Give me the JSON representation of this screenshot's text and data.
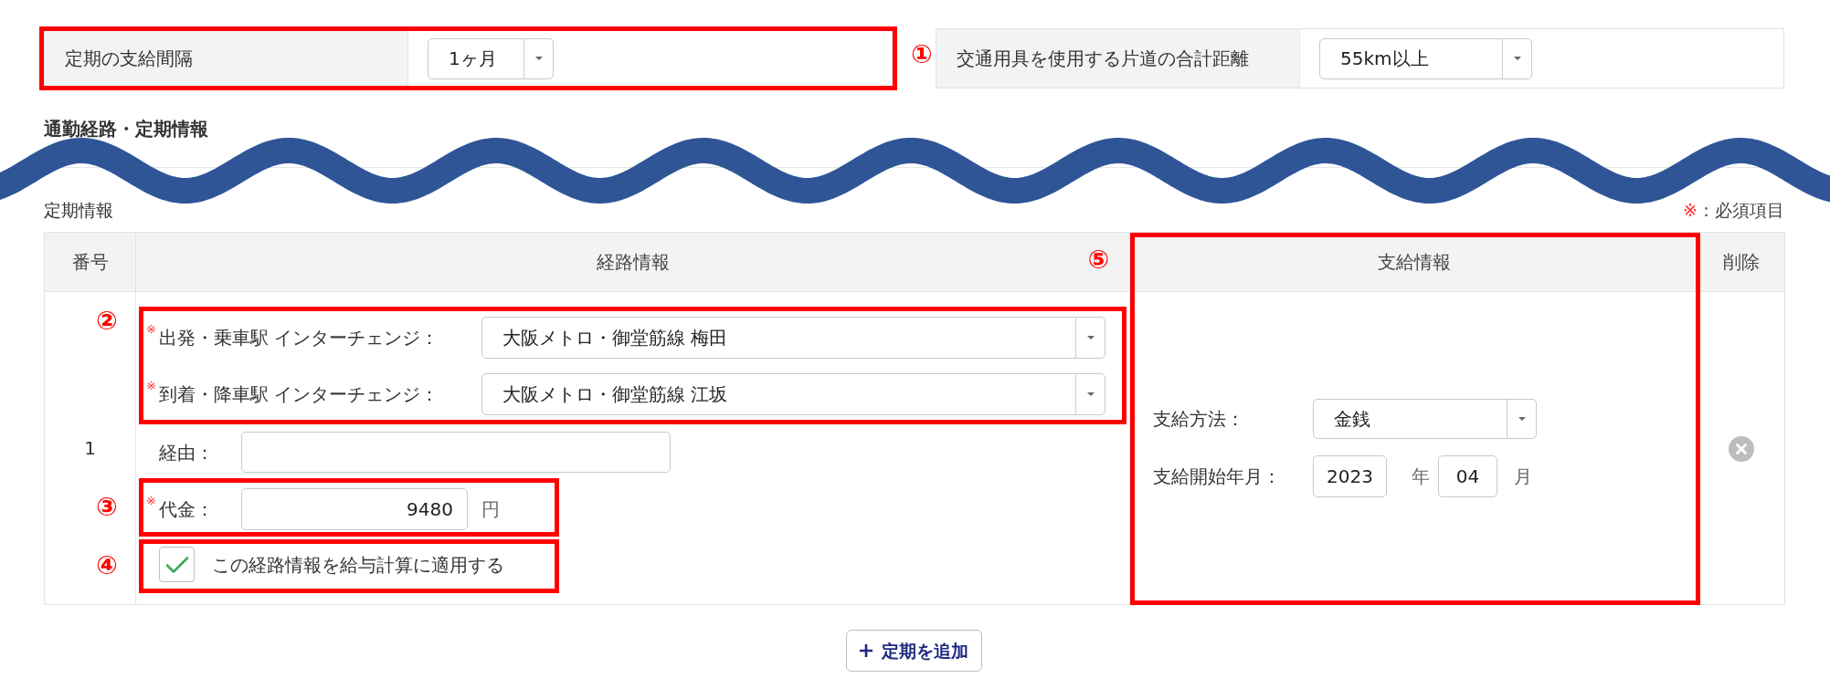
{
  "settings": [
    {
      "label": "定期の支給間隔",
      "value": "1ヶ月",
      "callout": "①"
    },
    {
      "label": "交通用具を使用する片道の合計距離",
      "value": "55km以上"
    }
  ],
  "section": {
    "title": "通勤経路・定期情報"
  },
  "pass_info": {
    "title": "定期情報",
    "legend": {
      "mark": "※",
      "text": "：必須項目"
    }
  },
  "table": {
    "columns": [
      {
        "label": "番号"
      },
      {
        "label": "経路情報"
      },
      {
        "label": "支給情報",
        "callout": "⑤"
      },
      {
        "label": "削除"
      }
    ],
    "rows": [
      {
        "number": "1",
        "stations": {
          "callout": "②",
          "fields": [
            {
              "required_mark": "※",
              "label": "出発・乗車駅 インターチェンジ：",
              "value": "大阪メトロ・御堂筋線 梅田"
            },
            {
              "required_mark": "※",
              "label": "到着・降車駅 インターチェンジ：",
              "value": "大阪メトロ・御堂筋線 江坂"
            }
          ]
        },
        "via": {
          "label": "経由："
        },
        "fare": {
          "callout": "③",
          "required_mark": "※",
          "label": "代金：",
          "value": "9480",
          "unit": "円"
        },
        "apply": {
          "callout": "④",
          "checked": true,
          "label": "この経路情報を給与計算に適用する"
        },
        "payment": {
          "method": {
            "label": "支給方法：",
            "value": "金銭"
          },
          "start": {
            "label": "支給開始年月：",
            "year": "2023",
            "year_unit": "年",
            "month": "04",
            "month_unit": "月"
          }
        }
      }
    ]
  },
  "add_button": {
    "label": "定期を追加"
  }
}
